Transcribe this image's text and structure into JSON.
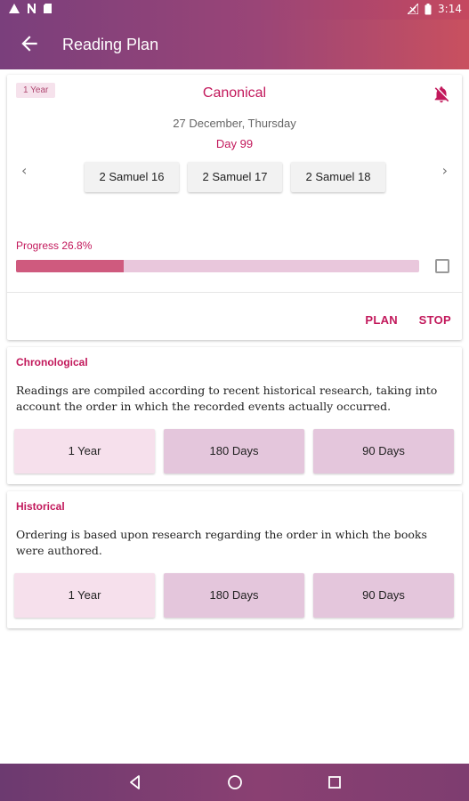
{
  "status_bar": {
    "time": "3:14"
  },
  "app_bar": {
    "title": "Reading Plan"
  },
  "current_plan": {
    "badge": "1 Year",
    "title": "Canonical",
    "date": "27 December, Thursday",
    "day": "Day 99",
    "chapters": [
      "2 Samuel 16",
      "2 Samuel 17",
      "2 Samuel 18"
    ],
    "progress_label": "Progress 26.8%",
    "progress_fraction": 0.268,
    "actions": {
      "plan": "PLAN",
      "stop": "STOP"
    }
  },
  "sections": [
    {
      "title": "Chronological",
      "description": "Readings are compiled according to recent historical research, taking into account the order in which the recorded events actually occurred.",
      "options": [
        "1 Year",
        "180 Days",
        "90 Days"
      ]
    },
    {
      "title": "Historical",
      "description": "Ordering is based upon research regarding the order in which the books were authored.",
      "options": [
        "1 Year",
        "180 Days",
        "90 Days"
      ]
    }
  ],
  "colors": {
    "accent": "#c2185b",
    "app_bar_start": "#7a3f7c",
    "app_bar_end": "#c9505f",
    "progress_fill": "#cf5a7e",
    "progress_track": "#e9c7dc"
  }
}
